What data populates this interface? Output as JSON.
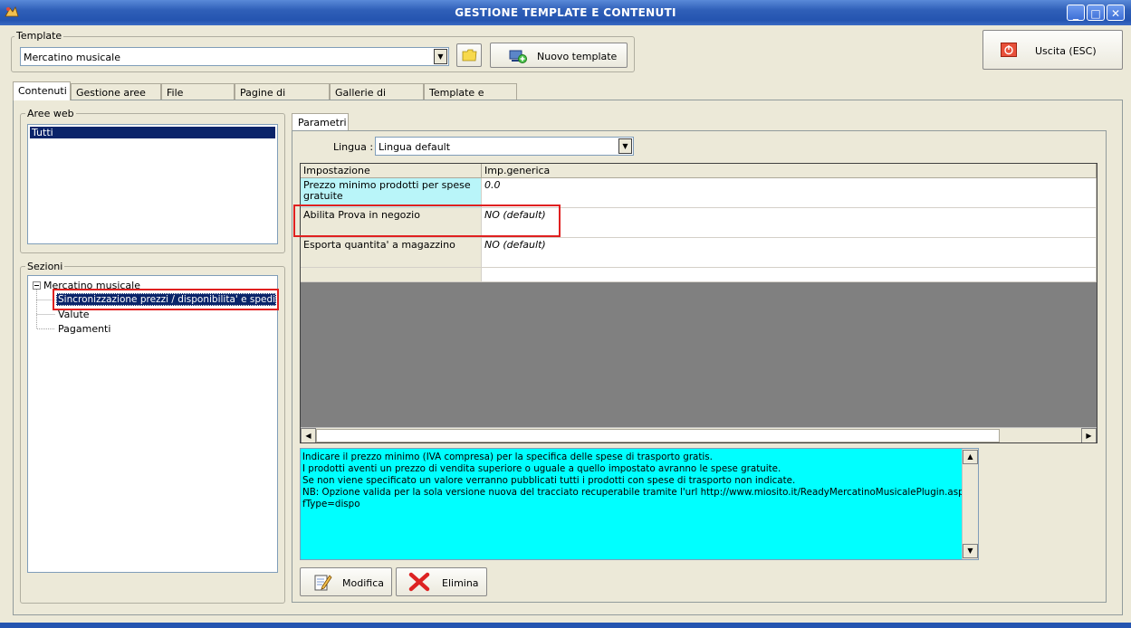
{
  "window": {
    "title": "GESTIONE TEMPLATE E CONTENUTI",
    "minimize": "_",
    "maximize": "□",
    "close": "✕"
  },
  "template": {
    "group_label": "Template",
    "selected": "Mercatino musicale",
    "new_label": "Nuovo template"
  },
  "exit_label": "Uscita (ESC)",
  "tabs": [
    {
      "label": "Contenuti",
      "active": true
    },
    {
      "label": "Gestione aree web",
      "active": false
    },
    {
      "label": "File aggiuntivi",
      "active": false
    },
    {
      "label": "Pagine di contenuti",
      "active": false
    },
    {
      "label": "Gallerie di immagini",
      "active": false
    },
    {
      "label": "Template e plugins",
      "active": false
    }
  ],
  "aree_web": {
    "label": "Aree web",
    "items": [
      "Tutti"
    ]
  },
  "sezioni": {
    "label": "Sezioni",
    "root": "Mercatino musicale",
    "children": [
      "Sincronizzazione prezzi / disponibilita' e spedizione",
      "Valute",
      "Pagamenti"
    ]
  },
  "parametri": {
    "tab_label": "Parametri",
    "lingua_label": "Lingua :",
    "lingua_value": "Lingua default",
    "columns": [
      "Impostazione",
      "Imp.generica"
    ],
    "rows": [
      {
        "setting": "Prezzo minimo prodotti per spese gratuite",
        "value": "0.0"
      },
      {
        "setting": "Abilita Prova in negozio",
        "value": "NO (default)"
      },
      {
        "setting": "Esporta quantita' a magazzino",
        "value": "NO (default)"
      },
      {
        "setting": "",
        "value": ""
      }
    ]
  },
  "description": {
    "lines": [
      "Indicare il prezzo minimo (IVA compresa) per la specifica delle spese di trasporto gratis.",
      "I prodotti aventi un prezzo di vendita superiore o uguale a quello impostato avranno le spese gratuite.",
      "Se non viene specificato un valore verranno pubblicati tutti i prodotti con spese di trasporto non indicate.",
      "NB: Opzione valida per la sola versione nuova del tracciato recuperabile tramite l'url http://www.miosito.it/ReadyMercatinoMusicalePlugin.asp?",
      "fType=dispo"
    ]
  },
  "actions": {
    "modify": "Modifica",
    "delete": "Elimina"
  },
  "colors": {
    "highlight": "#0a246a",
    "cyan": "#00ffff",
    "light_cyan": "#b9f5f9",
    "red_box": "#e02020",
    "grid_gray": "#808080"
  }
}
